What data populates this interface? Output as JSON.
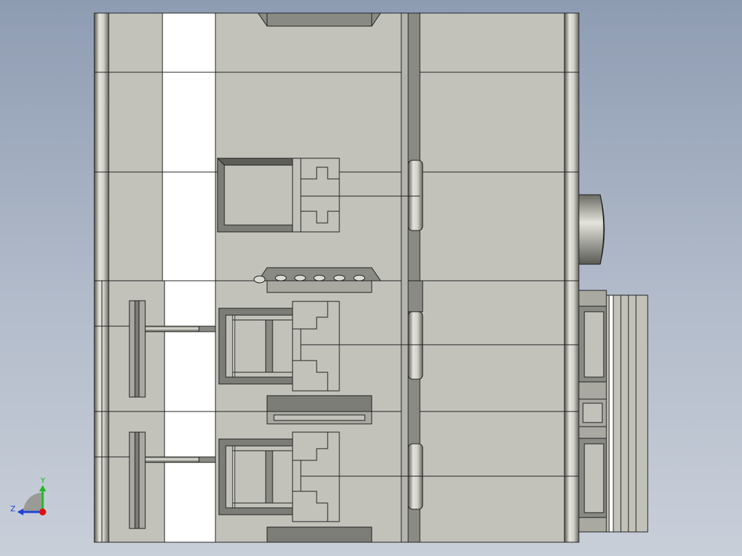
{
  "viewport": {
    "background_top": "#8e9cb2",
    "background_bottom": "#c9cfd9"
  },
  "colors": {
    "body_face": "#c2c2ba",
    "white_strip": "#ffffff",
    "dark_part": "#7d7d78",
    "mid_part": "#a9a9a2",
    "edge": "#1c1c1c",
    "axis_y": "#22b822",
    "axis_z": "#1f3fd6",
    "axis_x_dot": "#e01010"
  },
  "triad": {
    "y_label": "Y",
    "z_label": "Z"
  }
}
